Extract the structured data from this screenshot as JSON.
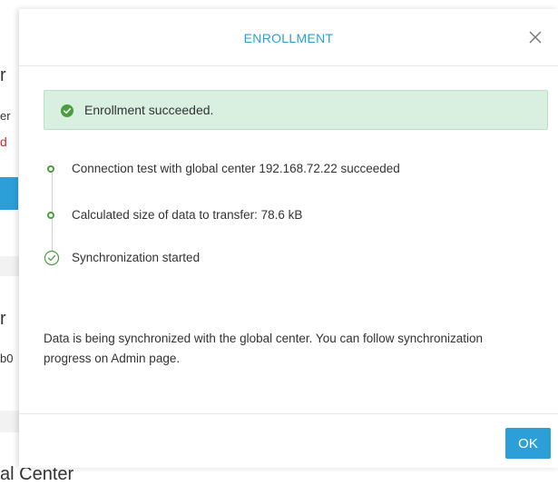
{
  "background": {
    "fragments": [
      "r",
      "er",
      "d",
      "r",
      "b0",
      "al Center"
    ],
    "colors": {
      "link_red": "#c9302c",
      "blue_button": "#2d9fd8"
    }
  },
  "modal": {
    "title": "ENROLLMENT",
    "close_icon": "close-x-icon",
    "alert": {
      "icon": "check-circle-icon",
      "text": "Enrollment succeeded.",
      "background": "#d9efdf"
    },
    "steps": [
      {
        "text": "Connection test with global center 192.168.72.22 succeeded",
        "state": "complete"
      },
      {
        "text": "Calculated size of data to transfer: 78.6 kB",
        "state": "complete"
      },
      {
        "text": "Synchronization started",
        "state": "done"
      }
    ],
    "info": "Data is being synchronized with the global center. You can follow synchronization progress on Admin page.",
    "ok_label": "OK"
  },
  "colors": {
    "accent": "#2d9fd8",
    "success": "#4a9e3e"
  }
}
